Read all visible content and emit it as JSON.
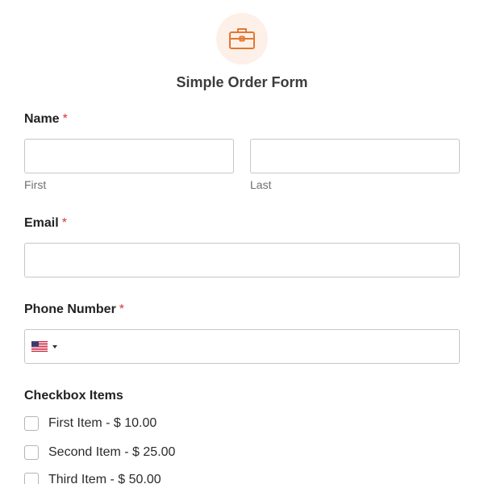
{
  "form": {
    "title": "Simple Order Form",
    "icon": "briefcase-icon",
    "accent_color": "#e27730"
  },
  "name_field": {
    "label": "Name",
    "required_mark": "*",
    "first": {
      "value": "",
      "sublabel": "First"
    },
    "last": {
      "value": "",
      "sublabel": "Last"
    }
  },
  "email_field": {
    "label": "Email",
    "required_mark": "*",
    "value": ""
  },
  "phone_field": {
    "label": "Phone Number",
    "required_mark": "*",
    "country_flag": "us-flag-icon",
    "value": ""
  },
  "checkbox_field": {
    "label": "Checkbox Items",
    "items": [
      {
        "label": "First Item - $ 10.00",
        "checked": false
      },
      {
        "label": "Second Item - $ 25.00",
        "checked": false
      },
      {
        "label": "Third Item - $ 50.00",
        "checked": false
      }
    ]
  }
}
